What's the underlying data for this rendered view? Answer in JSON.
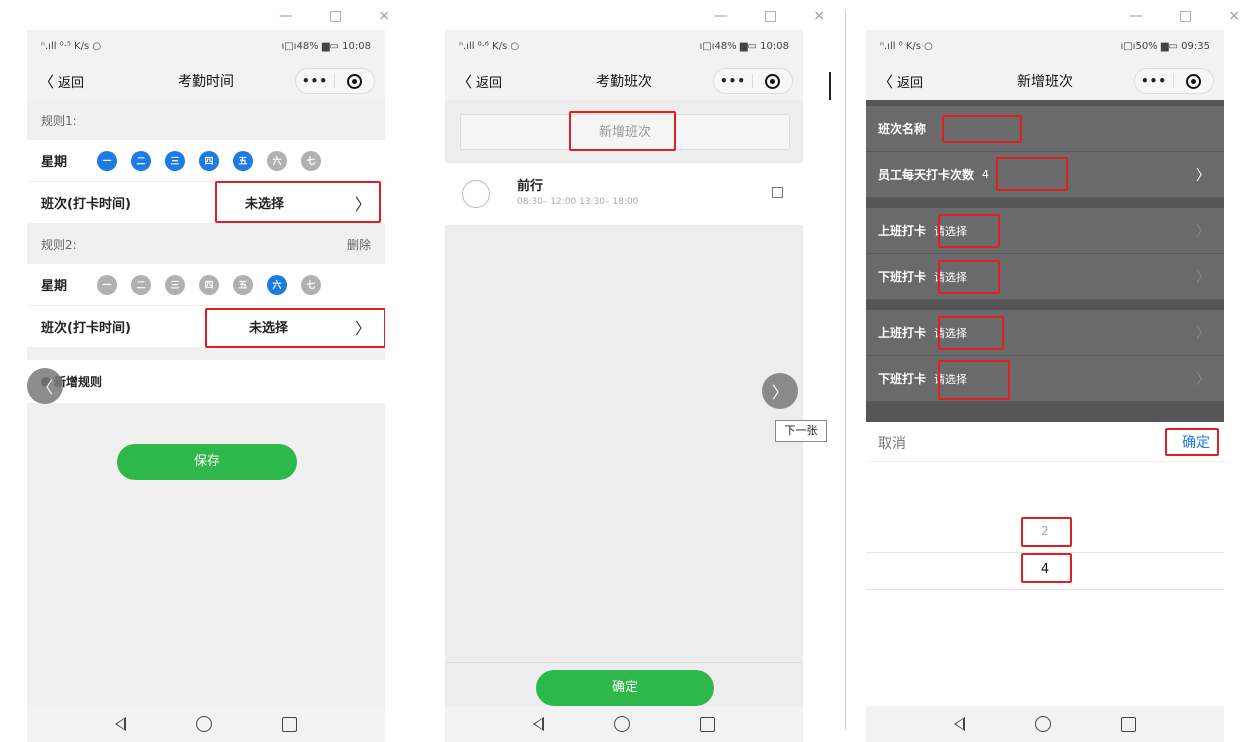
{
  "window_controls": {
    "minimize": "—",
    "maximize": "□",
    "close": "×"
  },
  "panels": [
    {
      "status": {
        "left": "ⁿ.ıll ⁰·⁵ K/s ○",
        "right": "ı□ı48% ▆▭ 10:08"
      },
      "nav": {
        "back": "返回",
        "title": "考勤时间",
        "more": "•••"
      },
      "rule1_label": "规则1:",
      "weekday_label": "星期",
      "days": [
        "一",
        "二",
        "三",
        "四",
        "五",
        "六",
        "七"
      ],
      "shift_label": "班次(打卡时间)",
      "shift_value": "未选择",
      "rule2_label": "规则2:",
      "delete_label": "删除",
      "add_rule": "新增规则",
      "save": "保存"
    },
    {
      "status": {
        "left": "ⁿ.ıll ⁰·⁶ K/s ○",
        "right": "ı□ı48% ▆▭ 10:08"
      },
      "nav": {
        "back": "返回",
        "title": "考勤班次",
        "more": "•••"
      },
      "add_shift": "新增班次",
      "shift_name": "前行",
      "shift_time": "08:30– 12:00  13:30– 18:00",
      "confirm": "确定",
      "next_tip": "下一张"
    },
    {
      "status": {
        "left": "ⁿ.ıll ⁰ K/s ○",
        "right": "ı□ı50% ▆▭ 09:35"
      },
      "nav": {
        "back": "返回",
        "title": "新增班次",
        "more": "•••"
      },
      "name_label": "班次名称",
      "count_label": "员工每天打卡次数",
      "count_value": "4",
      "on_label": "上班打卡",
      "off_label": "下班打卡",
      "please_select": "请选择",
      "cancel": "取消",
      "confirm": "确定",
      "picker_prev": "2",
      "picker_selected": "4"
    }
  ]
}
